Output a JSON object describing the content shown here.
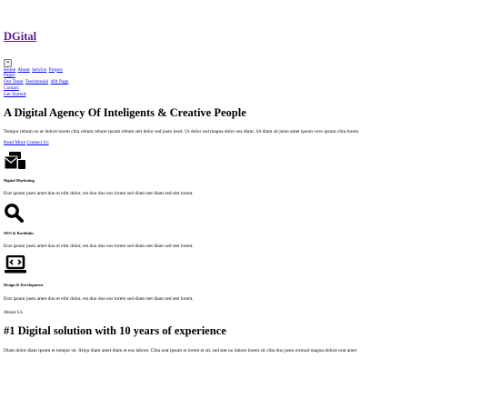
{
  "navbar": {
    "brand": "DGital",
    "toggler_icon": "≡",
    "links": [
      "Home",
      "About",
      "Service",
      "Project"
    ],
    "pages_label": "Pages",
    "pages_links": [
      "Our Team",
      "Testimonial",
      "404 Page"
    ],
    "contact": "Contact",
    "cta": "Get Started"
  },
  "hero": {
    "title": "A Digital Agency Of Inteligents & Creative People",
    "text": "Tempor rebum no at dolore lorem clita rebum rebum ipsum rebum stet dolor sed justo kasd. Ut dolor sed magna dolor sea diam. Sit diam sit justo amet ipsum vero ipsum clita lorem",
    "read_more": "Read More",
    "contact_us": "Contact Us"
  },
  "services": [
    {
      "icon": "mail-bulk-icon",
      "title": "Digital Marketing",
      "text": "Erat ipsum justo amet duo et elitr dolor, est duo duo eos lorem sed diam stet diam sed stet lorem."
    },
    {
      "icon": "search-icon",
      "title": "SEO & Backlinks",
      "text": "Erat ipsum justo amet duo et elitr dolor, est duo duo eos lorem sed diam stet diam sed stet lorem."
    },
    {
      "icon": "laptop-code-icon",
      "title": "Design & Development",
      "text": "Erat ipsum justo amet duo et elitr dolor, est duo duo eos lorem sed diam stet diam sed stet lorem."
    }
  ],
  "about": {
    "label": "About Us",
    "title": "#1 Digital solution with 10 years of experience",
    "text": "Diam dolor diam ipsum et tempor sit. Aliqu diam amet diam et eos labore. Clita erat ipsum et lorem et sit, sed stet no labore lorem sit clita duo justo eirmod magna dolore erat amet"
  }
}
